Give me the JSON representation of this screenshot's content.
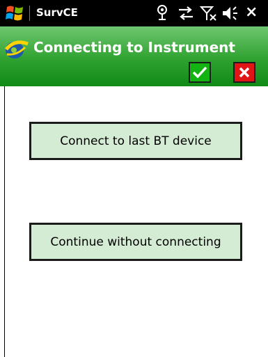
{
  "taskbar": {
    "app_name": "SurvCE",
    "close_label": "×",
    "icons": [
      "windows-start-icon",
      "gps-signal-icon",
      "connectivity-arrows-icon",
      "no-signal-icon",
      "speaker-icon"
    ]
  },
  "titlebar": {
    "title": "Connecting to Instrument",
    "ok_icon": "check-icon",
    "cancel_icon": "close-x-icon",
    "colors": {
      "bar": "#2fa230",
      "ok": "#13b313",
      "cancel": "#e11515"
    }
  },
  "main": {
    "connect_last_label": "Connect to last BT device",
    "continue_label": "Continue without connecting",
    "button_color": "#d4ecd4"
  }
}
